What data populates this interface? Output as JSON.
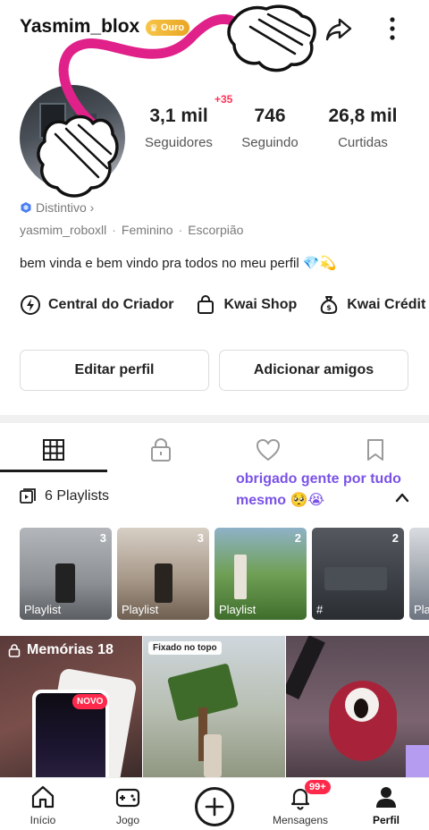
{
  "header": {
    "username": "Yasmim_blox",
    "badge": "Ouro"
  },
  "stats": {
    "new_followers": "+35",
    "followers": {
      "value": "3,1 mil",
      "label": "Seguidores"
    },
    "following": {
      "value": "746",
      "label": "Seguindo"
    },
    "likes": {
      "value": "26,8 mil",
      "label": "Curtidas"
    }
  },
  "profile": {
    "distintivo": "Distintivo ›",
    "handle": "yasmim_roboxll",
    "gender": "Feminino",
    "sign": "Escorpião",
    "bio": "bem vinda e bem vindo pra todos no meu perfil 💎💫"
  },
  "shortcuts": [
    {
      "label": "Central do Criador",
      "icon": "lightning-icon"
    },
    {
      "label": "Kwai Shop",
      "icon": "shopping-bag-icon"
    },
    {
      "label": "Kwai Crédit",
      "icon": "money-bag-icon"
    }
  ],
  "buttons": {
    "edit": "Editar perfil",
    "add_friends": "Adicionar amigos"
  },
  "overlay_caption": "obrigado gente por tudo mesmo 🥺😭",
  "playlists": {
    "title": "6 Playlists",
    "items": [
      {
        "count": "3",
        "label": "Playlist",
        "bg": "#8c8f93"
      },
      {
        "count": "3",
        "label": "Playlist",
        "bg": "#8a7a69"
      },
      {
        "count": "2",
        "label": "Playlist",
        "bg": "#4f8a3a"
      },
      {
        "count": "2",
        "label": "#",
        "bg": "#3b3f45"
      },
      {
        "count": "",
        "label": "Pla",
        "bg": "#9aa0a8"
      }
    ]
  },
  "memories": {
    "title": "Memórias 18",
    "novo": "NOVO",
    "pinned": "Fixado no topo"
  },
  "nav": {
    "home": "Início",
    "game": "Jogo",
    "messages": "Mensagens",
    "messages_badge": "99+",
    "profile": "Perfil"
  },
  "colors": {
    "accent_purple": "#7a52e6",
    "badge_red": "#ff2a4b",
    "gold": "#f7c548",
    "drawing_pink": "#e0218a"
  }
}
